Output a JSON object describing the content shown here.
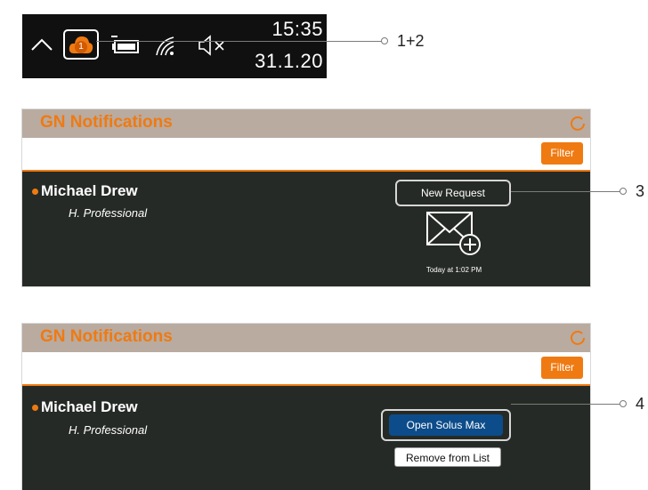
{
  "taskbar": {
    "time": "15:35",
    "date": "31.1.20",
    "cloud_badge": "1",
    "icons": [
      "chevron-up-icon",
      "cloud-notification-icon",
      "battery-icon",
      "wifi-icon",
      "volume-muted-icon"
    ]
  },
  "callouts": {
    "c1": "1+2",
    "c3": "3",
    "c4": "4"
  },
  "panel1": {
    "title": "GN Notifications",
    "filter_label": "Filter",
    "contact": {
      "name": "Michael Drew",
      "role": "H. Professional"
    },
    "request_label": "New Request",
    "request_time": "Today at 1:02 PM"
  },
  "panel2": {
    "title": "GN Notifications",
    "filter_label": "Filter",
    "contact": {
      "name": "Michael Drew",
      "role": "H. Professional"
    },
    "open_label": "Open Solus Max",
    "remove_label": "Remove from List"
  },
  "colors": {
    "accent": "#ef7a12",
    "header": "#b9aba0",
    "body": "#262a26",
    "primary_button": "#0d4c8a"
  }
}
